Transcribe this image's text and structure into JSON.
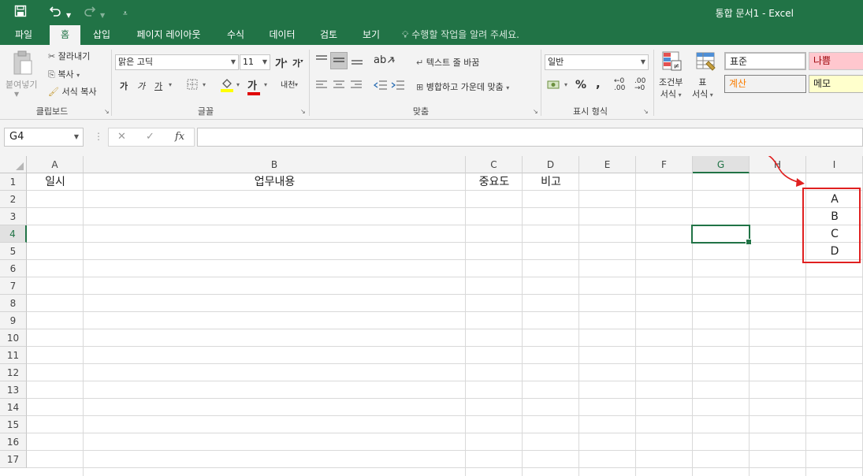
{
  "titlebar": {
    "title": "통합 문서1 - Excel",
    "save_icon": "save-icon",
    "undo_icon": "undo-icon",
    "redo_icon": "redo-icon",
    "customize_icon": "customize-qat-icon"
  },
  "tabs": [
    "파일",
    "홈",
    "삽입",
    "페이지 레이아웃",
    "수식",
    "데이터",
    "검토",
    "보기"
  ],
  "active_tab": "홈",
  "tellme": "수행할 작업을 알려 주세요.",
  "ribbon": {
    "clipboard": {
      "paste": "붙여넣기",
      "cut": "잘라내기",
      "copy": "복사",
      "format_painter": "서식 복사",
      "label": "클립보드"
    },
    "font": {
      "font_name": "맑은 고딕",
      "font_size": "11",
      "increase": "가",
      "decrease": "가",
      "bold": "가",
      "italic": "가",
      "underline": "가",
      "font_color": "가",
      "phonetic": "내천",
      "label": "글꼴"
    },
    "alignment": {
      "wrap_text": "텍스트 줄 바꿈",
      "merge_center": "병합하고 가운데 맞춤",
      "label": "맞춤"
    },
    "number": {
      "format": "일반",
      "percent": "%",
      "comma": ",",
      "label": "표시 형식"
    },
    "styles": {
      "conditional": [
        "조건부",
        "서식"
      ],
      "format_table": [
        "표",
        "서식"
      ],
      "normal": "표준",
      "bad": "나쁨",
      "calculation": "계산",
      "note": "메모"
    }
  },
  "formula_bar": {
    "name_box": "G4",
    "cancel": "✕",
    "enter": "✓",
    "fx": "fx",
    "content": ""
  },
  "columns": [
    "A",
    "B",
    "C",
    "D",
    "E",
    "F",
    "G",
    "H",
    "I"
  ],
  "selected_column": "G",
  "rows": [
    "1",
    "2",
    "3",
    "4",
    "5",
    "6",
    "7",
    "8",
    "9",
    "10",
    "11",
    "12",
    "13",
    "14",
    "15",
    "16",
    "17"
  ],
  "selected_row": "4",
  "cells": {
    "A1": "일시",
    "B1": "업무내용",
    "C1": "중요도",
    "D1": "비고",
    "I2": "A",
    "I3": "B",
    "I4": "C",
    "I5": "D"
  },
  "colors": {
    "excel_green": "#217346",
    "annotation_red": "#e02020"
  }
}
